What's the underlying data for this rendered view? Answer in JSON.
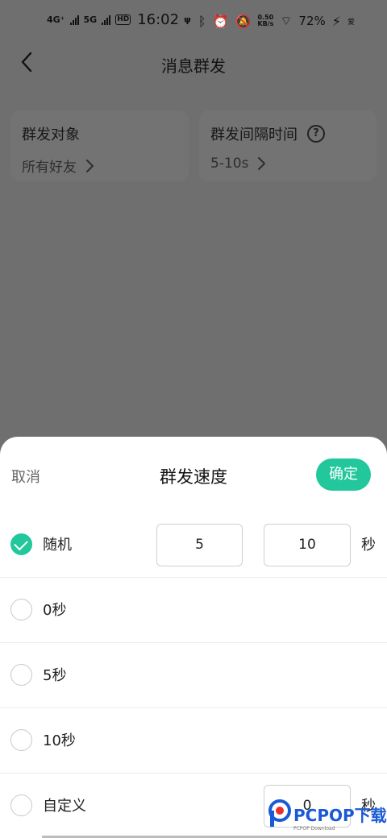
{
  "status_bar": {
    "net1": "4G⁺",
    "net2": "5G",
    "hd": "HD",
    "time": "16:02",
    "speed_value": "0.50",
    "speed_unit": "KB/s",
    "battery": "72%",
    "tail": "爱"
  },
  "header": {
    "title": "消息群发"
  },
  "cards": {
    "target": {
      "title": "群发对象",
      "value": "所有好友"
    },
    "interval": {
      "title": "群发间隔时间",
      "value": "5-10s"
    }
  },
  "sheet": {
    "cancel_label": "取消",
    "title": "群发速度",
    "confirm_label": "确定",
    "options": [
      {
        "label": "随机",
        "checked": true,
        "min": "5",
        "max": "10",
        "unit": "秒"
      },
      {
        "label": "0秒",
        "checked": false
      },
      {
        "label": "5秒",
        "checked": false
      },
      {
        "label": "10秒",
        "checked": false
      },
      {
        "label": "自定义",
        "checked": false,
        "value": "0",
        "unit": "秒"
      }
    ]
  },
  "watermark": {
    "text": "PCPOP下载",
    "sub": "PCPOP Download"
  },
  "colors": {
    "accent": "#22c79b",
    "overlay": "#6f6f6f"
  }
}
